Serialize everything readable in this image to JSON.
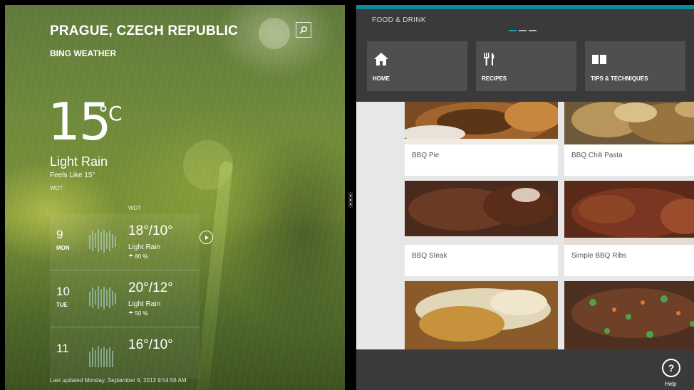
{
  "weather": {
    "city": "PRAGUE, CZECH REPUBLIC",
    "provider": "BING WEATHER",
    "search_icon": "search-icon",
    "current": {
      "temp": "15",
      "unit": "°C",
      "condition": "Light Rain",
      "feels_like": "Feels Like 15°",
      "station": "WDT"
    },
    "forecast_station": "WDT",
    "days": [
      {
        "num": "9",
        "dow": "MON",
        "hilo": "18°/10°",
        "condition": "Light Rain",
        "precip": "80 %"
      },
      {
        "num": "10",
        "dow": "TUE",
        "hilo": "20°/12°",
        "condition": "Light Rain",
        "precip": "50 %"
      },
      {
        "num": "11",
        "dow": "",
        "hilo": "16°/10°",
        "condition": "",
        "precip": ""
      }
    ],
    "updated": "Last updated Monday, September 9, 2013 9:54:56 AM"
  },
  "food": {
    "title": "FOOD & DRINK",
    "accent_color": "#0e8a9e",
    "nav": [
      {
        "label": "HOME",
        "icon": "home-icon"
      },
      {
        "label": "RECIPES",
        "icon": "utensils-icon"
      },
      {
        "label": "TIPS & TECHNIQUES",
        "icon": "book-icon"
      }
    ],
    "recipes": [
      {
        "title": "BBQ Pie"
      },
      {
        "title": "BBQ Chili Pasta"
      },
      {
        "title": "BBQ Steak"
      },
      {
        "title": "Simple BBQ Ribs"
      }
    ],
    "help_label": "Help"
  }
}
